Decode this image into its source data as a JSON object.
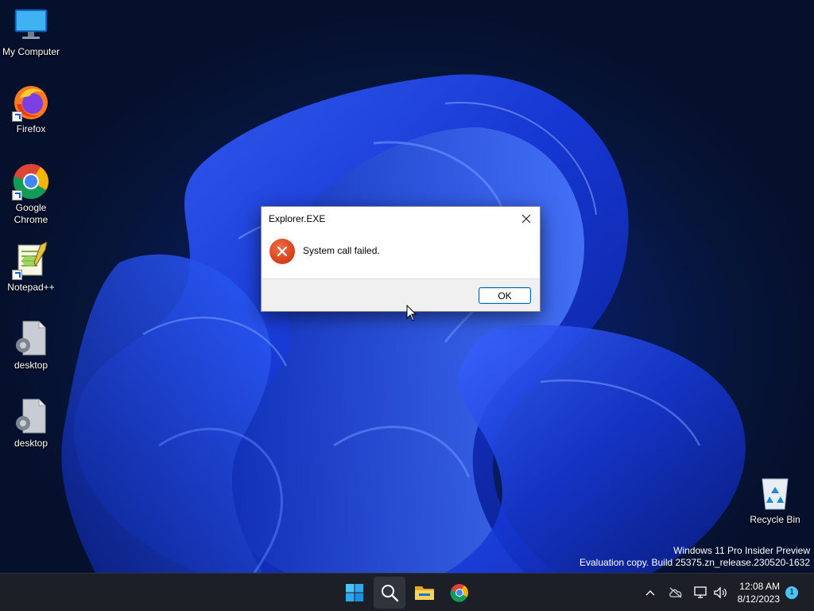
{
  "desktop": {
    "icons": [
      {
        "label": "My Computer",
        "icon": "monitor-icon"
      },
      {
        "label": "Firefox",
        "icon": "firefox-icon"
      },
      {
        "label": "Google Chrome",
        "icon": "chrome-icon"
      },
      {
        "label": "Notepad++",
        "icon": "notepadpp-icon"
      },
      {
        "label": "desktop",
        "icon": "settings-file-icon"
      },
      {
        "label": "desktop",
        "icon": "settings-file-icon"
      },
      {
        "label": "Recycle Bin",
        "icon": "recycle-bin-icon"
      }
    ],
    "watermark": {
      "line1": "Windows 11 Pro Insider Preview",
      "line2": "Evaluation copy. Build 25375.zn_release.230520-1632"
    }
  },
  "dialog": {
    "title": "Explorer.EXE",
    "close_glyph": "✕",
    "message": "System call failed.",
    "ok_label": "OK",
    "icon": "error-icon"
  },
  "taskbar": {
    "apps": [
      "start-icon",
      "search-icon",
      "file-explorer-icon",
      "chrome-icon"
    ],
    "tray": {
      "chevron_glyph": "^",
      "time": "12:08 AM",
      "date": "8/12/2023",
      "notification_count": "1"
    }
  },
  "colors": {
    "accent": "#0067c0",
    "error": "#d9441c",
    "taskbar_bg": "#1c1f26",
    "wallpaper_blue": "#1a3ee8"
  }
}
